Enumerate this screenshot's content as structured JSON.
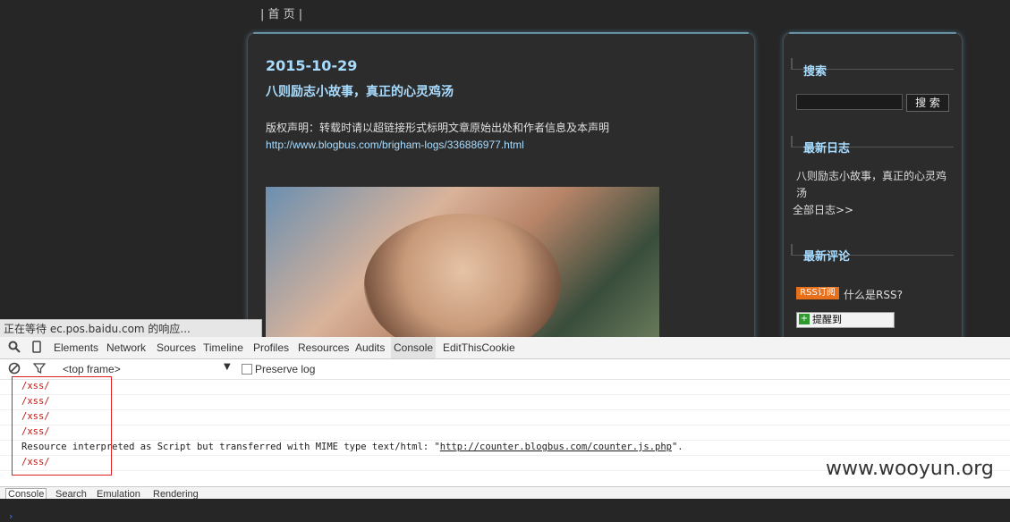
{
  "topnav": {
    "label": "| 首 页 |"
  },
  "post": {
    "date": "2015-10-29",
    "title": "八则励志小故事，真正的心灵鸡汤",
    "copyright": "版权声明：转载时请以超链接形式标明文章原始出处和作者信息及本声明",
    "link": "http://www.blogbus.com/brigham-logs/336886977.html"
  },
  "sidebar": {
    "search_heading": "搜索",
    "search_button": "搜 索",
    "recent_posts_heading": "最新日志",
    "recent_post_1_line1": "八则励志小故事，真正的心灵鸡",
    "recent_post_1_line2": "汤",
    "all_posts": "全部日志>>",
    "recent_comments_heading": "最新评论",
    "rss_badge": "RSS订阅",
    "rss_question": "什么是RSS?",
    "tixing_label": "提醒到"
  },
  "status_tip": "正在等待 ec.pos.baidu.com 的响应...",
  "devtools": {
    "tabs": [
      "Elements",
      "Network",
      "Sources",
      "Timeline",
      "Profiles",
      "Resources",
      "Audits",
      "Console",
      "EditThisCookie"
    ],
    "frame_select": "<top frame>",
    "preserve_log": "Preserve log",
    "console_lines": [
      "/xss/",
      "/xss/",
      "/xss/",
      "/xss/",
      "Resource interpreted as Script but transferred with MIME type text/html: \"",
      "/xss/"
    ],
    "warn_url": "http://counter.blogbus.com/counter.js.php",
    "warn_tail": "\".",
    "drawer_tabs": [
      "Console",
      "Search",
      "Emulation",
      "Rendering"
    ]
  },
  "watermark": "www.wooyun.org"
}
